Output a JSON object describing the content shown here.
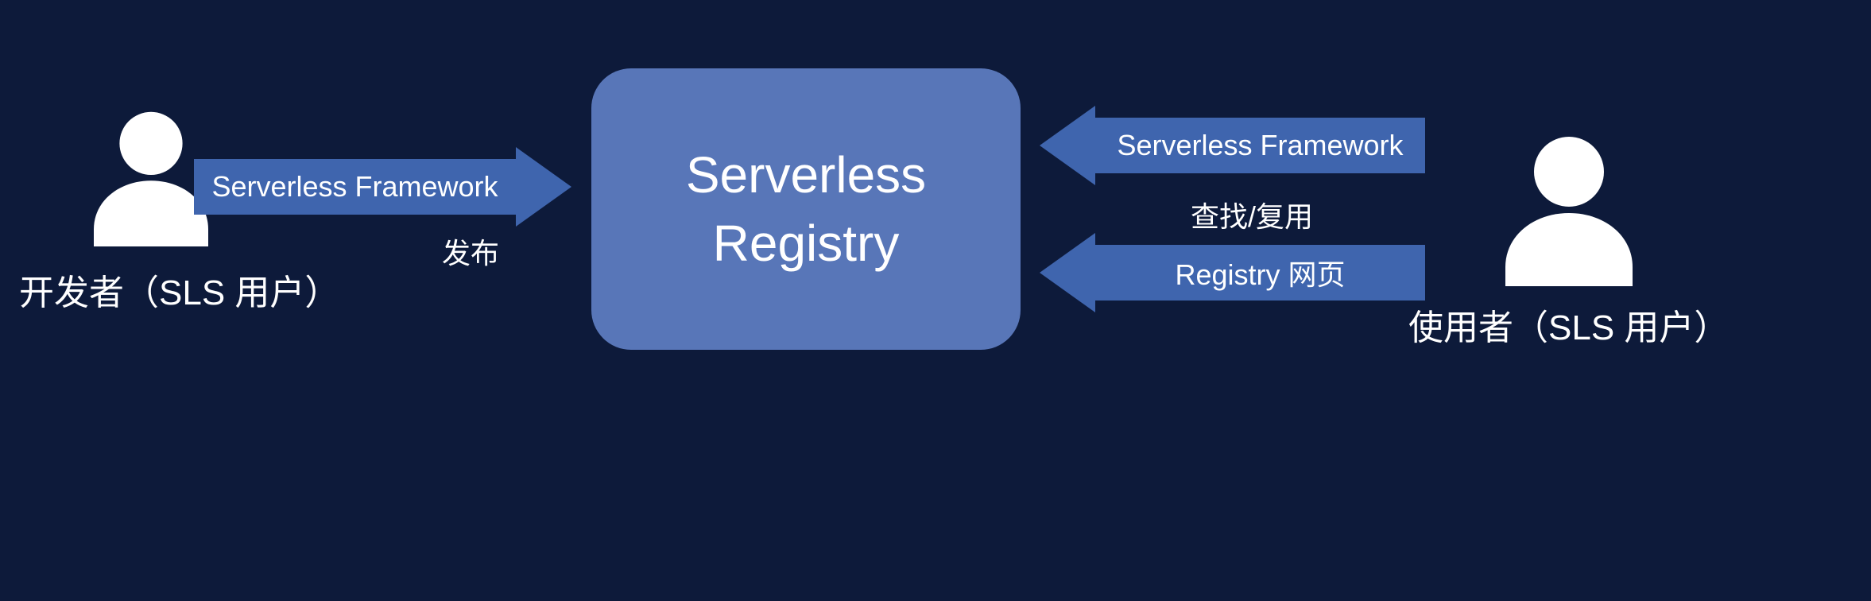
{
  "left_user": {
    "label": "开发者（SLS 用户）"
  },
  "left_arrow": {
    "label": "Serverless Framework",
    "sublabel": "发布"
  },
  "center": {
    "line1": "Serverless",
    "line2": "Registry"
  },
  "right_arrow_top": {
    "label": "Serverless Framework"
  },
  "right_middle_label": "查找/复用",
  "right_arrow_bottom": {
    "label": "Registry 网页"
  },
  "right_user": {
    "label": "使用者（SLS 用户）"
  },
  "colors": {
    "bg": "#0d1a3a",
    "box": "#5876b8",
    "arrow": "#3f65ae",
    "text": "#ffffff"
  }
}
